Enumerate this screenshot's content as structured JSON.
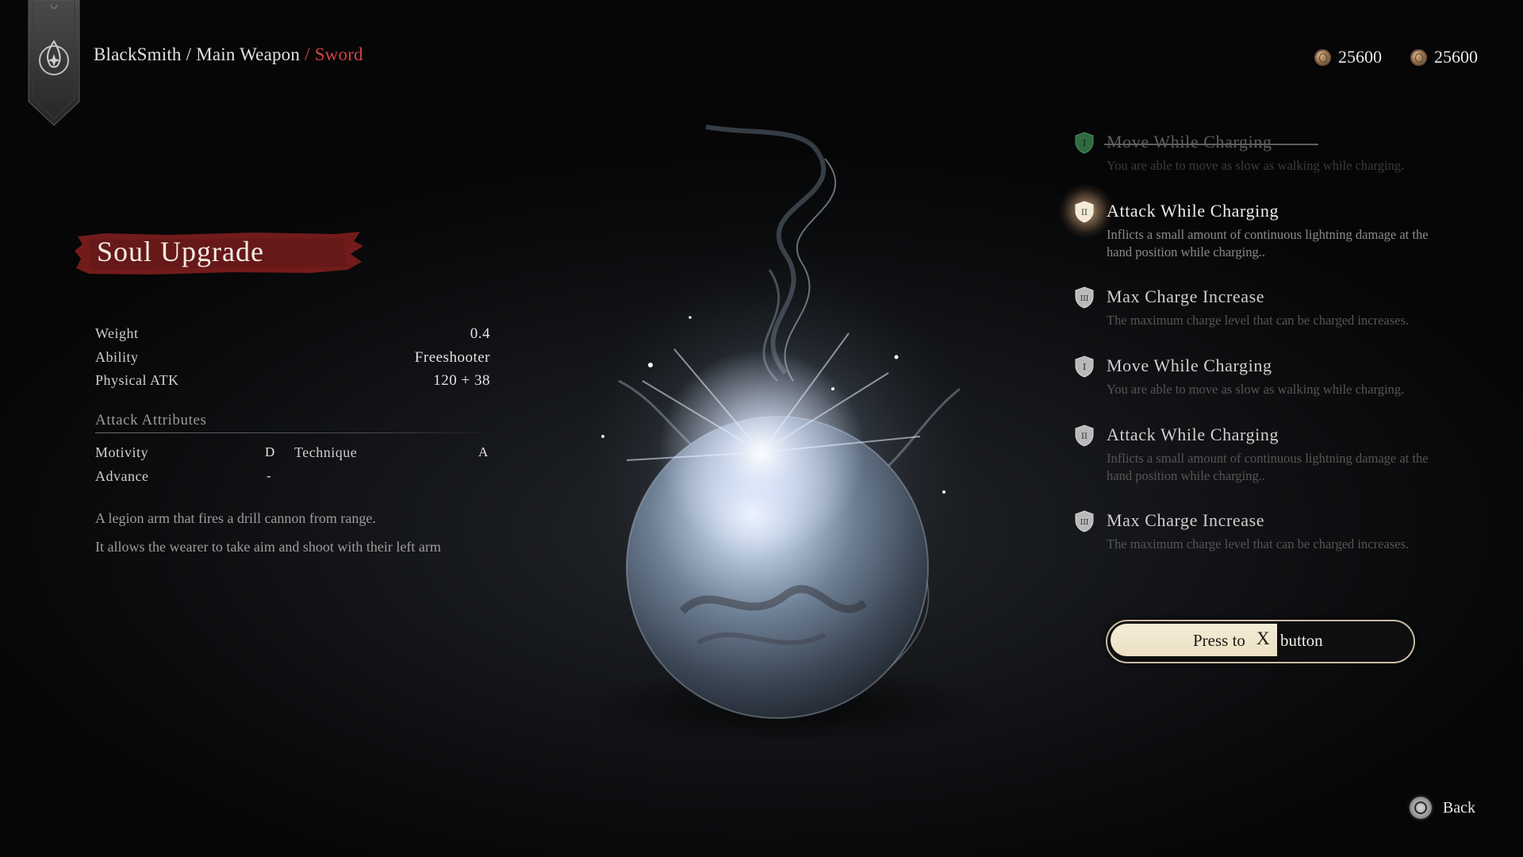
{
  "breadcrumb": {
    "part1": "BlackSmith",
    "sep1": "/",
    "part2": "Main Weapon",
    "sep2": "/",
    "current": "Sword"
  },
  "currency": [
    {
      "icon": "coin-icon",
      "amount": "25600"
    },
    {
      "icon": "coin-icon",
      "amount": "25600"
    }
  ],
  "title": "Soul Upgrade",
  "stats": [
    {
      "label": "Weight",
      "value": "0.4"
    },
    {
      "label": "Ability",
      "value": "Freeshooter"
    },
    {
      "label": "Physical ATK",
      "value": "120 + 38"
    }
  ],
  "attack_attributes": {
    "heading": "Attack Attributes",
    "motivity": {
      "label": "Motivity",
      "grade": "D"
    },
    "technique": {
      "label": "Technique",
      "grade": "A"
    },
    "advance": {
      "label": "Advance",
      "grade": "-"
    }
  },
  "description": [
    "A legion arm that fires a drill cannon from range.",
    "It allows the wearer to take aim and shoot with their left arm"
  ],
  "skills": [
    {
      "numeral": "I",
      "title": "Move While Charging",
      "desc": "You are able to move as slow as walking while charging.",
      "state": "done"
    },
    {
      "numeral": "II",
      "title": "Attack While Charging",
      "desc": "Inflicts a small amount of continuous lightning damage at the hand position while charging..",
      "state": "active"
    },
    {
      "numeral": "III",
      "title": "Max Charge Increase",
      "desc": "The maximum charge level that can be charged increases.",
      "state": "locked"
    },
    {
      "numeral": "I",
      "title": "Move While Charging",
      "desc": "You are able to move as slow as walking while charging.",
      "state": "locked"
    },
    {
      "numeral": "II",
      "title": "Attack While Charging",
      "desc": "Inflicts a small amount of continuous lightning damage at the hand position while charging..",
      "state": "locked"
    },
    {
      "numeral": "III",
      "title": "Max Charge Increase",
      "desc": "The maximum charge level that can be charged increases.",
      "state": "locked"
    }
  ],
  "press_button": {
    "label_before": "Press to",
    "key": "X",
    "label_after": "button",
    "progress": 0.55
  },
  "back_button": {
    "icon": "circle-button-icon",
    "label": "Back"
  },
  "colors": {
    "accent_red": "#d24545",
    "brush_red": "#7a1d1d",
    "done_shield": "#2f6b3f"
  }
}
